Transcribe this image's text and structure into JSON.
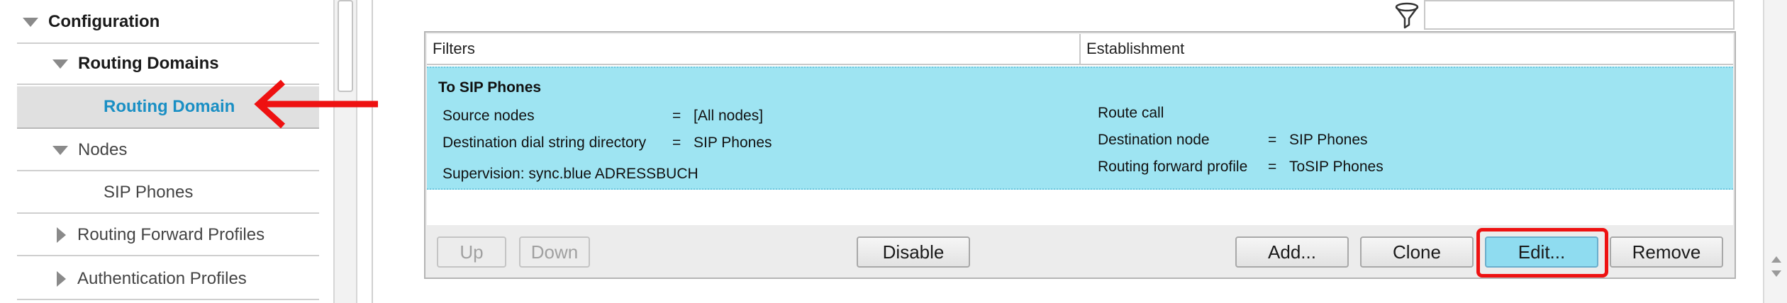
{
  "sidebar": {
    "items": [
      {
        "label": "Configuration",
        "icon": "triangle-down-icon"
      },
      {
        "label": "Routing Domains",
        "icon": "triangle-down-icon"
      },
      {
        "label": "Routing Domain",
        "selected": true
      },
      {
        "label": "Nodes",
        "icon": "triangle-down-icon"
      },
      {
        "label": "SIP Phones"
      },
      {
        "label": "Routing Forward Profiles",
        "icon": "triangle-right-icon"
      },
      {
        "label": "Authentication Profiles",
        "icon": "triangle-right-icon"
      }
    ]
  },
  "toolbar": {
    "filter_value": ""
  },
  "table": {
    "columns": [
      "Filters",
      "Establishment"
    ],
    "rows": [
      {
        "name": "To SIP Phones",
        "filters": [
          {
            "key": "Source nodes",
            "op": "=",
            "value": "[All nodes]"
          },
          {
            "key": "Destination dial string directory",
            "op": "=",
            "value": "SIP Phones"
          }
        ],
        "supervision": "Supervision: sync.blue ADRESSBUCH",
        "establishment": {
          "action": "Route call",
          "params": [
            {
              "key": "Destination node",
              "op": "=",
              "value": "SIP Phones"
            },
            {
              "key": "Routing forward profile",
              "op": "=",
              "value": "ToSIP Phones"
            }
          ]
        },
        "selected": true
      }
    ]
  },
  "buttons": {
    "up": "Up",
    "down": "Down",
    "disable": "Disable",
    "add": "Add...",
    "clone": "Clone",
    "edit": "Edit...",
    "remove": "Remove"
  },
  "colors": {
    "selection": "#9ee4f2",
    "sidebar_selected_text": "#1a8fc4",
    "annotation_red": "#ee1111"
  }
}
